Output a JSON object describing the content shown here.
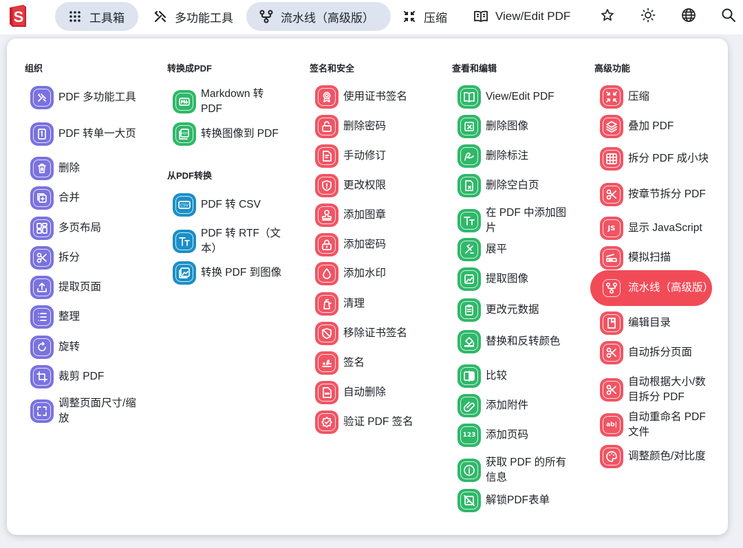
{
  "app": {
    "logo_letter": "S",
    "nav": [
      {
        "label": "工具箱",
        "icon": "grid-dots-icon"
      },
      {
        "label": "多功能工具",
        "icon": "tools-icon"
      },
      {
        "label": "流水线（高级版）",
        "icon": "pipeline-icon"
      },
      {
        "label": "压缩",
        "icon": "compress-icon"
      },
      {
        "label": "View/Edit PDF",
        "icon": "book-icon"
      }
    ],
    "right_icons": [
      "star-icon",
      "sun-icon",
      "globe-icon",
      "search-icon"
    ]
  },
  "colors": {
    "purple": "#7a72df",
    "green": "#2fb86a",
    "red": "#f05564",
    "blue": "#1b8fc7",
    "highlight": "#f24b58",
    "active_nav": "#dde3ef"
  },
  "categories": {
    "organize": {
      "title": "组织",
      "items": [
        {
          "label": "PDF 多功能工具",
          "icon": "tools-icon"
        },
        {
          "label": "PDF 转单一大页",
          "icon": "single-page-icon"
        },
        {
          "label": "删除",
          "icon": "trash-icon"
        },
        {
          "label": "合并",
          "icon": "merge-icon"
        },
        {
          "label": "多页布局",
          "icon": "layout-icon"
        },
        {
          "label": "拆分",
          "icon": "scissors-icon"
        },
        {
          "label": "提取页面",
          "icon": "upload-icon"
        },
        {
          "label": "整理",
          "icon": "list-icon"
        },
        {
          "label": "旋转",
          "icon": "rotate-icon"
        },
        {
          "label": "裁剪 PDF",
          "icon": "crop-icon"
        },
        {
          "label": "调整页面尺寸/缩放",
          "icon": "fullscreen-icon"
        }
      ]
    },
    "convert_to": {
      "title": "转换成PDF",
      "items": [
        {
          "label": "Markdown 转 PDF",
          "icon": "markdown-icon"
        },
        {
          "label": "转换图像到 PDF",
          "icon": "pdf-image-icon"
        }
      ]
    },
    "convert_from": {
      "title": "从PDF转换",
      "items": [
        {
          "label": "PDF 转 CSV",
          "icon": "csv-icon"
        },
        {
          "label": "PDF 转 RTF（文本）",
          "icon": "text-icon"
        },
        {
          "label": "转换 PDF 到图像",
          "icon": "image-icon"
        }
      ]
    },
    "security": {
      "title": "签名和安全",
      "items": [
        {
          "label": "使用证书签名",
          "icon": "certificate-icon"
        },
        {
          "label": "删除密码",
          "icon": "unlock-icon"
        },
        {
          "label": "手动修订",
          "icon": "redact-icon"
        },
        {
          "label": "更改权限",
          "icon": "shield-icon"
        },
        {
          "label": "添加图章",
          "icon": "stamp-icon"
        },
        {
          "label": "添加密码",
          "icon": "lock-icon"
        },
        {
          "label": "添加水印",
          "icon": "drop-icon"
        },
        {
          "label": "清理",
          "icon": "sanitize-icon"
        },
        {
          "label": "移除证书签名",
          "icon": "remove-cert-icon"
        },
        {
          "label": "签名",
          "icon": "signature-icon"
        },
        {
          "label": "自动删除",
          "icon": "auto-redact-icon"
        },
        {
          "label": "验证 PDF 签名",
          "icon": "verify-icon"
        }
      ]
    },
    "view_edit": {
      "title": "查看和编辑",
      "items": [
        {
          "label": "View/Edit PDF",
          "icon": "book-icon"
        },
        {
          "label": "删除图像",
          "icon": "remove-image-icon"
        },
        {
          "label": "删除标注",
          "icon": "remove-annotation-icon"
        },
        {
          "label": "删除空白页",
          "icon": "blank-page-icon"
        },
        {
          "label": "在 PDF 中添加图片",
          "icon": "add-text-icon"
        },
        {
          "label": "展平",
          "icon": "flatten-icon"
        },
        {
          "label": "提取图像",
          "icon": "extract-image-icon"
        },
        {
          "label": "更改元数据",
          "icon": "clipboard-icon"
        },
        {
          "label": "替换和反转颜色",
          "icon": "fill-color-icon"
        },
        {
          "label": "比较",
          "icon": "compare-icon"
        },
        {
          "label": "添加附件",
          "icon": "attachment-icon"
        },
        {
          "label": "添加页码",
          "icon": "page-number-icon",
          "glyph": "123"
        },
        {
          "label": "获取 PDF 的所有信息",
          "icon": "info-icon"
        },
        {
          "label": "解锁PDF表单",
          "icon": "unlock-form-icon"
        }
      ]
    },
    "advanced": {
      "title": "高级功能",
      "items": [
        {
          "label": "压缩",
          "icon": "compress-icon"
        },
        {
          "label": "叠加 PDF",
          "icon": "layers-icon"
        },
        {
          "label": "拆分 PDF 成小块",
          "icon": "grid-icon"
        },
        {
          "label": "按章节拆分 PDF",
          "icon": "scissors-icon"
        },
        {
          "label": "显示 JavaScript",
          "icon": "javascript-icon",
          "glyph": "JS"
        },
        {
          "label": "模拟扫描",
          "icon": "scanner-icon"
        },
        {
          "label": "流水线（高级版）",
          "icon": "pipeline-icon"
        },
        {
          "label": "编辑目录",
          "icon": "toc-icon"
        },
        {
          "label": "自动拆分页面",
          "icon": "scissors-icon"
        },
        {
          "label": "自动根据大小/数目拆分 PDF",
          "icon": "scissors-icon"
        },
        {
          "label": "自动重命名 PDF 文件",
          "icon": "rename-icon",
          "glyph": "ab|"
        },
        {
          "label": "调整颜色/对比度",
          "icon": "palette-icon"
        }
      ]
    }
  }
}
